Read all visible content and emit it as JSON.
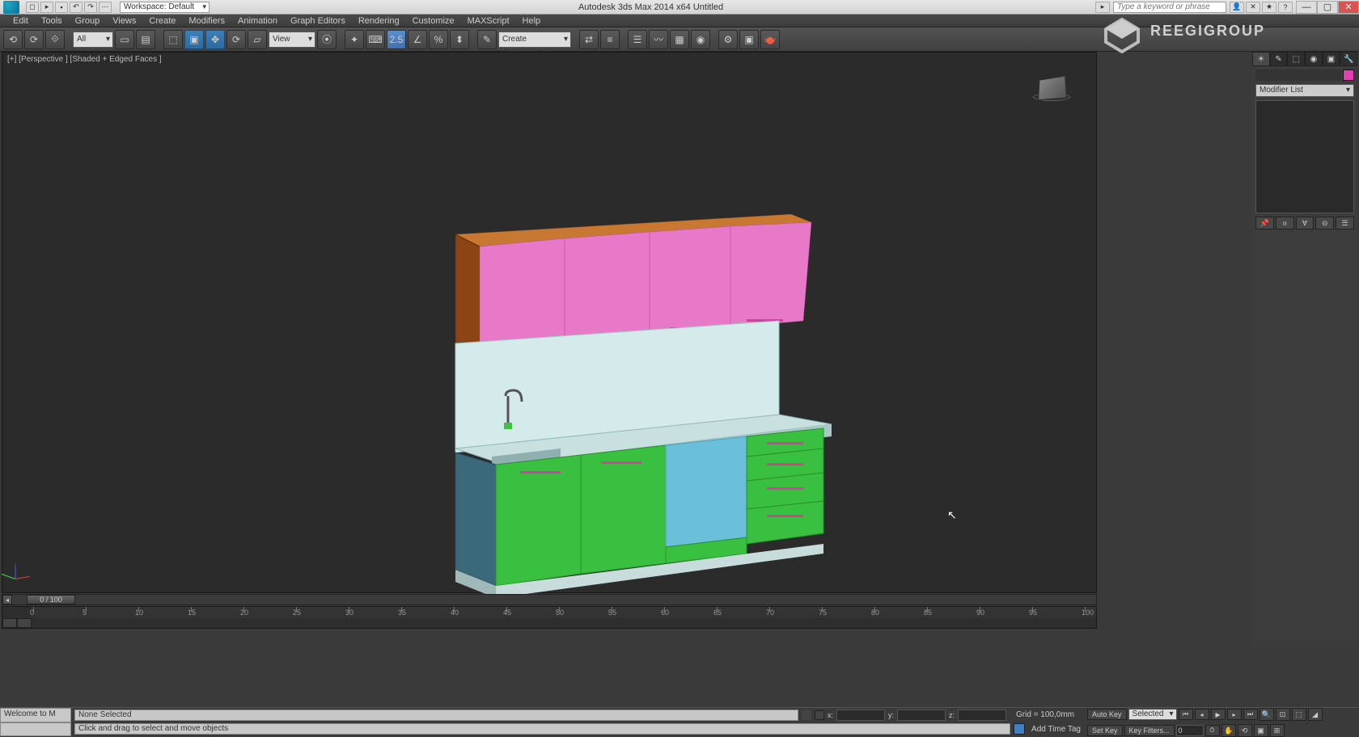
{
  "titlebar": {
    "workspace_label": "Workspace: Default",
    "title": "Autodesk 3ds Max  2014 x64      Untitled",
    "search_placeholder": "Type a keyword or phrase"
  },
  "menubar": {
    "items": [
      "Edit",
      "Tools",
      "Group",
      "Views",
      "Create",
      "Modifiers",
      "Animation",
      "Graph Editors",
      "Rendering",
      "Customize",
      "MAXScript",
      "Help"
    ]
  },
  "toolbar": {
    "selection_filter": "All",
    "named_selection": "View",
    "named_set": "Create Selection Set"
  },
  "viewport": {
    "label": "[+] [Perspective ] [Shaded + Edged Faces ]"
  },
  "timeline": {
    "slider": "0 / 100",
    "ticks": [
      "0",
      "5",
      "10",
      "15",
      "20",
      "25",
      "30",
      "35",
      "40",
      "45",
      "50",
      "55",
      "60",
      "65",
      "70",
      "75",
      "80",
      "85",
      "90",
      "95",
      "100"
    ]
  },
  "rpanel": {
    "modifier_list": "Modifier List"
  },
  "status": {
    "macro": "Welcome to M",
    "selection": "None Selected",
    "prompt": "Click and drag to select and move objects",
    "x": "",
    "y": "",
    "z": "",
    "grid": "Grid = 100,0mm",
    "autokey": "Auto Key",
    "setkey": "Set Key",
    "selected": "Selected",
    "keyfilters": "Key Filters...",
    "addtimetag": "Add Time Tag"
  },
  "watermark": {
    "text": "REEGIGROUP"
  }
}
